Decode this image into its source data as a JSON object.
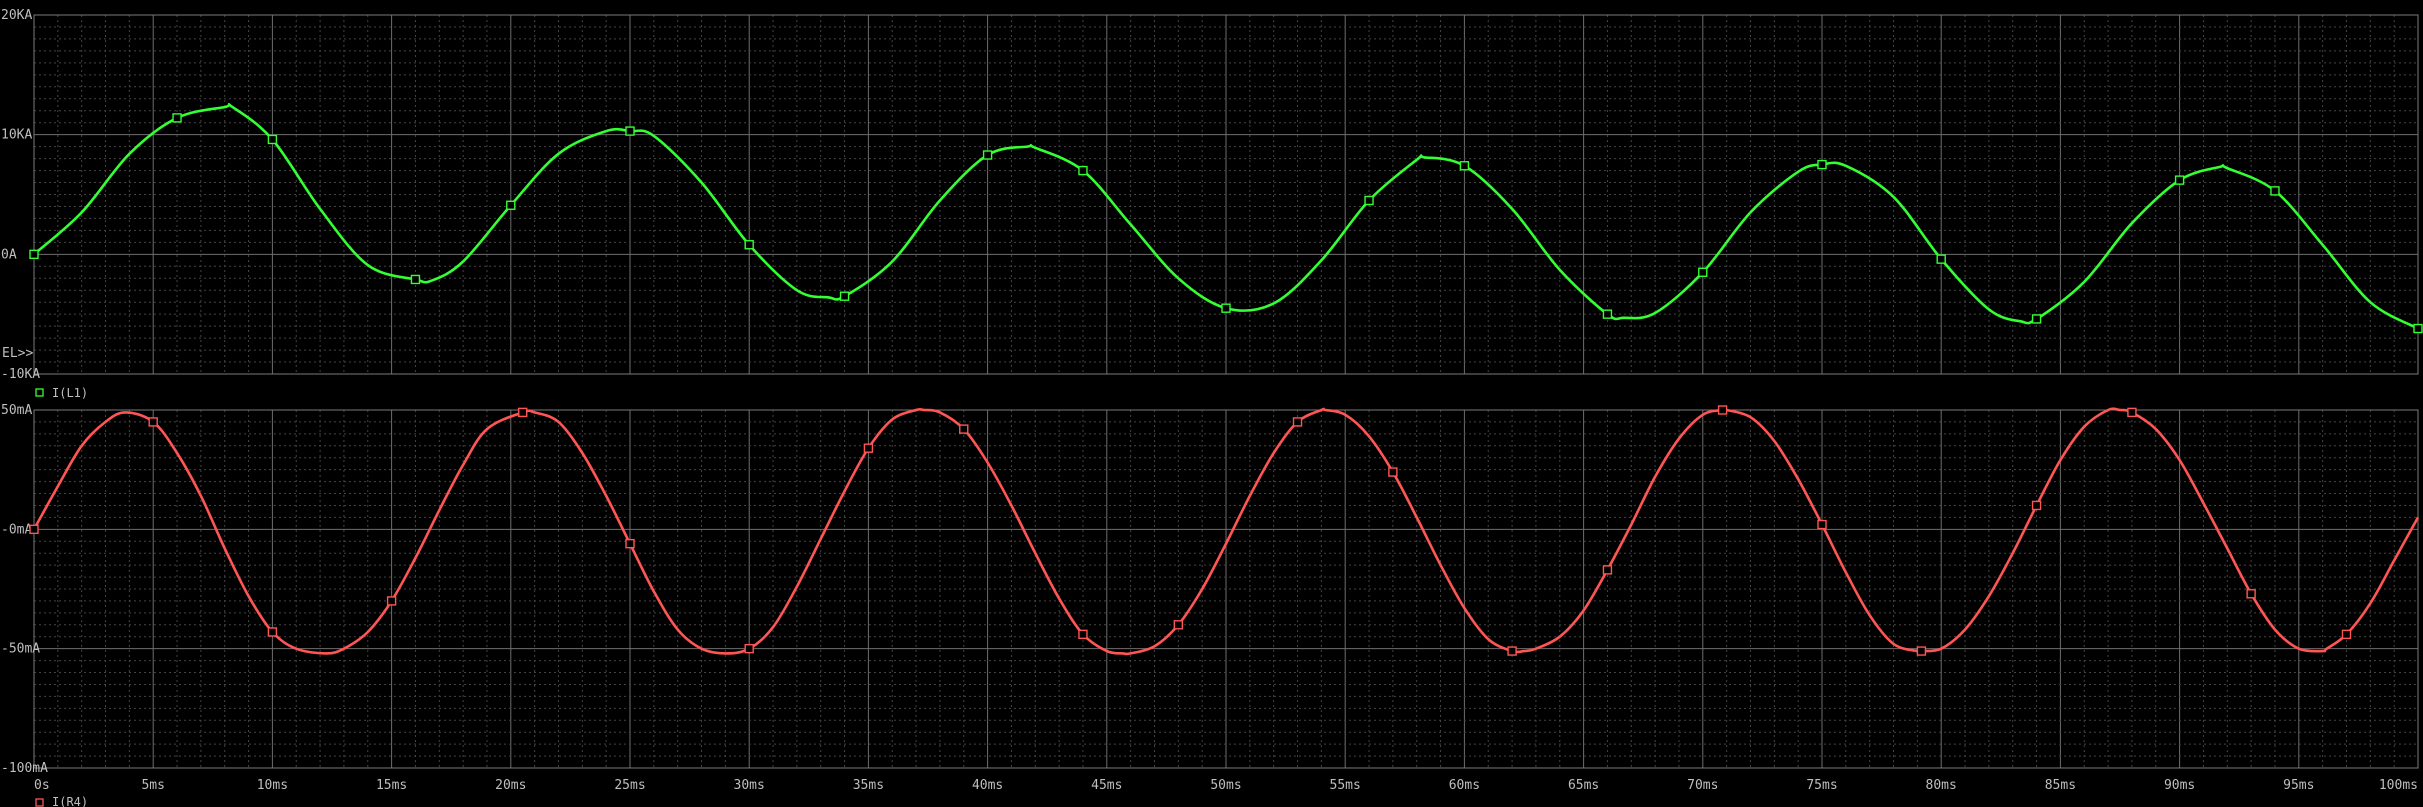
{
  "top_plot_marker": "EL>>",
  "chart_data": [
    {
      "type": "line",
      "title": "",
      "xlabel": "",
      "ylabel": "",
      "x_unit": "ms",
      "xlim": [
        0,
        100
      ],
      "ylim": [
        -10,
        20
      ],
      "grid": true,
      "legend_position": "bottom-left",
      "y_ticks": [
        {
          "value": 20,
          "label": "20KA"
        },
        {
          "value": 10,
          "label": "10KA"
        },
        {
          "value": 0,
          "label": "0A"
        },
        {
          "value": -10,
          "label": "-10KA"
        }
      ],
      "series": [
        {
          "name": "I(L1)",
          "color": "#33ff33",
          "marker": "square",
          "x": [
            0,
            2,
            4,
            6,
            8,
            8.33,
            10,
            12,
            14,
            16,
            16.67,
            18,
            20,
            22,
            24,
            25,
            26,
            28,
            30,
            32,
            33.33,
            34,
            36,
            38,
            40,
            41.67,
            42,
            44,
            46,
            48,
            50,
            52,
            54,
            56,
            58,
            58.33,
            60,
            62,
            64,
            66,
            66.67,
            68,
            70,
            72,
            74,
            75,
            76,
            78,
            80,
            82,
            83.33,
            84,
            86,
            88,
            90,
            91.67,
            92,
            94,
            96,
            98,
            100
          ],
          "values": [
            0,
            3.5,
            8.4,
            11.4,
            12.3,
            12.3,
            9.6,
            3.8,
            -0.9,
            -2.1,
            -2.2,
            -0.6,
            4.1,
            8.4,
            10.3,
            10.3,
            9.9,
            6.0,
            0.8,
            -3.0,
            -3.6,
            -3.5,
            -0.6,
            4.5,
            8.3,
            9.0,
            8.9,
            7.0,
            2.5,
            -2.0,
            -4.5,
            -4.1,
            -0.5,
            4.5,
            7.9,
            8.1,
            7.4,
            3.8,
            -1.3,
            -5.0,
            -5.3,
            -4.9,
            -1.5,
            3.5,
            6.9,
            7.5,
            7.4,
            4.8,
            -0.4,
            -4.6,
            -5.6,
            -5.4,
            -2.3,
            2.6,
            6.2,
            7.3,
            7.2,
            5.3,
            0.8,
            -4.0,
            -6.2
          ]
        }
      ]
    },
    {
      "type": "line",
      "title": "",
      "xlabel": "",
      "ylabel": "",
      "x_unit": "ms",
      "xlim": [
        0,
        100
      ],
      "ylim": [
        -100,
        50
      ],
      "grid": true,
      "legend_position": "bottom-left",
      "y_ticks": [
        {
          "value": 50,
          "label": "50mA"
        },
        {
          "value": 0,
          "label": "-0mA"
        },
        {
          "value": -50,
          "label": "-50mA"
        },
        {
          "value": -100,
          "label": "-100mA"
        }
      ],
      "x_ticks": [
        {
          "value": 0,
          "label": "0s"
        },
        {
          "value": 5,
          "label": "5ms"
        },
        {
          "value": 10,
          "label": "10ms"
        },
        {
          "value": 15,
          "label": "15ms"
        },
        {
          "value": 20,
          "label": "20ms"
        },
        {
          "value": 25,
          "label": "25ms"
        },
        {
          "value": 30,
          "label": "30ms"
        },
        {
          "value": 35,
          "label": "35ms"
        },
        {
          "value": 40,
          "label": "40ms"
        },
        {
          "value": 45,
          "label": "45ms"
        },
        {
          "value": 50,
          "label": "50ms"
        },
        {
          "value": 55,
          "label": "55ms"
        },
        {
          "value": 60,
          "label": "60ms"
        },
        {
          "value": 65,
          "label": "65ms"
        },
        {
          "value": 70,
          "label": "70ms"
        },
        {
          "value": 75,
          "label": "75ms"
        },
        {
          "value": 80,
          "label": "80ms"
        },
        {
          "value": 85,
          "label": "85ms"
        },
        {
          "value": 90,
          "label": "90ms"
        },
        {
          "value": 95,
          "label": "95ms"
        },
        {
          "value": 100,
          "label": "100ms"
        }
      ],
      "series": [
        {
          "name": "I(R4)",
          "color": "#ff5555",
          "marker": "square",
          "x": [
            0,
            1,
            2,
            3,
            3.83,
            5,
            6,
            7,
            8,
            9,
            10,
            11,
            12.25,
            13,
            14,
            15,
            16,
            17,
            18,
            19,
            20.5,
            21,
            22,
            23,
            24,
            25,
            26,
            27,
            28,
            29,
            30,
            31,
            32,
            33,
            34,
            35,
            36,
            37,
            37.33,
            38,
            39,
            40,
            41,
            42,
            43,
            44,
            45,
            45.67,
            46,
            47,
            48,
            49,
            50,
            51,
            52,
            53,
            54,
            54.17,
            55,
            56,
            57,
            58,
            59,
            60,
            61,
            62,
            62.5,
            63,
            64,
            65,
            66,
            67,
            68,
            69,
            70,
            70.83,
            71,
            72,
            73,
            74,
            75,
            76,
            77,
            78,
            79,
            79.17,
            80,
            81,
            82,
            83,
            84,
            85,
            86,
            87,
            87.5,
            88,
            89,
            90,
            91,
            92,
            93,
            94,
            95,
            96,
            96.17,
            97,
            98,
            99,
            100
          ],
          "values": [
            0,
            18,
            35,
            45,
            49,
            45,
            32,
            14,
            -8,
            -28,
            -43,
            -50,
            -52,
            -50,
            -43,
            -30,
            -12,
            8,
            27,
            42,
            49,
            49,
            45,
            32,
            14,
            -6,
            -26,
            -42,
            -50,
            -52,
            -50,
            -41,
            -24,
            -4,
            16,
            34,
            46,
            50,
            50,
            49,
            42,
            28,
            10,
            -10,
            -29,
            -44,
            -51,
            -52,
            -52,
            -49,
            -40,
            -25,
            -6,
            14,
            32,
            45,
            50,
            50,
            48,
            39,
            24,
            5,
            -15,
            -33,
            -46,
            -51,
            -51,
            -50,
            -45,
            -34,
            -17,
            2,
            22,
            38,
            48,
            50,
            50,
            47,
            37,
            21,
            2,
            -18,
            -36,
            -48,
            -51,
            -51,
            -50,
            -42,
            -28,
            -10,
            10,
            29,
            43,
            50,
            50,
            49,
            42,
            29,
            11,
            -8,
            -27,
            -42,
            -50,
            -51,
            -50,
            -44,
            -31,
            -13,
            5
          ]
        }
      ]
    }
  ]
}
